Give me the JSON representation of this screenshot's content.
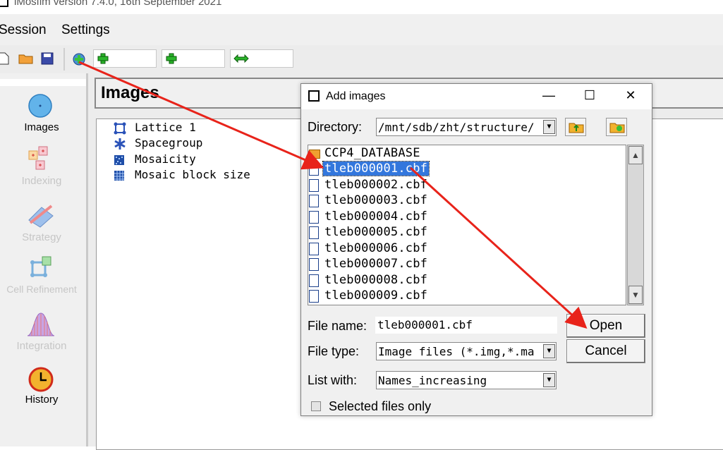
{
  "app": {
    "title": "iMosflm version 7.4.0, 16th September 2021"
  },
  "menu": {
    "items": [
      {
        "label": "Session"
      },
      {
        "label": "Settings"
      }
    ]
  },
  "toolbar": {
    "icons": [
      "new-file-icon",
      "open-folder-icon",
      "save-icon",
      "add-images-icon",
      "add-lattice-icon",
      "add-spacegroup-icon",
      "swap-arrows-icon"
    ]
  },
  "sidebar": {
    "items": [
      {
        "label": "Images",
        "icon": "circle-icon",
        "enabled": true
      },
      {
        "label": "Indexing",
        "icon": "indexing-icon",
        "enabled": false
      },
      {
        "label": "Strategy",
        "icon": "strategy-icon",
        "enabled": false
      },
      {
        "label": "Cell Refinement",
        "icon": "cell-refinement-icon",
        "enabled": false
      },
      {
        "label": "Integration",
        "icon": "integration-icon",
        "enabled": false
      },
      {
        "label": "History",
        "icon": "clock-icon",
        "enabled": true
      }
    ]
  },
  "main": {
    "header": "Images",
    "tree": [
      {
        "label": "Lattice 1",
        "icon": "lattice-icon"
      },
      {
        "label": "Spacegroup",
        "icon": "asterisk-icon"
      },
      {
        "label": "Mosaicity",
        "icon": "mosaicity-icon"
      },
      {
        "label": "Mosaic block size",
        "icon": "grid-icon"
      }
    ]
  },
  "dialog": {
    "title": "Add images",
    "window_buttons": {
      "minimize": "—",
      "maximize": "☐",
      "close": "✕"
    },
    "directory_label": "Directory:",
    "directory_value": "/mnt/sdb/zht/structure/",
    "files": [
      {
        "name": "CCP4_DATABASE",
        "type": "folder",
        "selected": false
      },
      {
        "name": "tleb000001.cbf",
        "type": "file",
        "selected": true
      },
      {
        "name": "tleb000002.cbf",
        "type": "file",
        "selected": false
      },
      {
        "name": "tleb000003.cbf",
        "type": "file",
        "selected": false
      },
      {
        "name": "tleb000004.cbf",
        "type": "file",
        "selected": false
      },
      {
        "name": "tleb000005.cbf",
        "type": "file",
        "selected": false
      },
      {
        "name": "tleb000006.cbf",
        "type": "file",
        "selected": false
      },
      {
        "name": "tleb000007.cbf",
        "type": "file",
        "selected": false
      },
      {
        "name": "tleb000008.cbf",
        "type": "file",
        "selected": false
      },
      {
        "name": "tleb000009.cbf",
        "type": "file",
        "selected": false
      }
    ],
    "file_name_label": "File name:",
    "file_name_value": "tleb000001.cbf",
    "file_type_label": "File type:",
    "file_type_value": "Image files (*.img,*.ma",
    "list_with_label": "List with:",
    "list_with_value": "Names_increasing",
    "open_button": "Open",
    "cancel_button": "Cancel",
    "selected_only_label": "Selected files only",
    "selected_only_checked": false
  },
  "annotations": {
    "arrow_color": "#e8231a"
  }
}
